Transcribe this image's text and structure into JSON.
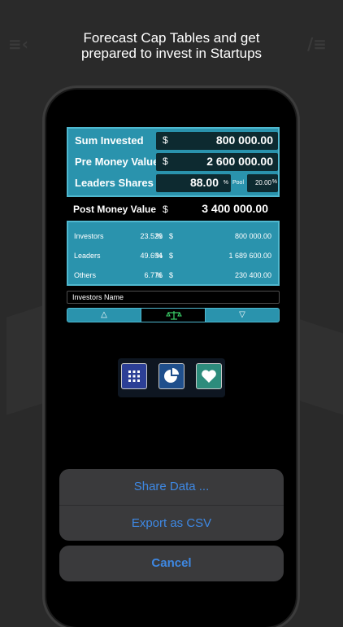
{
  "headline": {
    "line1": "Forecast Cap Tables and get",
    "line2": "prepared to invest in Startups"
  },
  "inputs": {
    "sum_invested": {
      "label": "Sum Invested",
      "currency": "$",
      "value": "800 000.00"
    },
    "pre_money": {
      "label": "Pre Money Value",
      "currency": "$",
      "value": "2 600 000.00"
    },
    "leaders_shares": {
      "label": "Leaders Shares",
      "value": "88.00",
      "unit": "%"
    },
    "pool": {
      "label": "Pool",
      "value": "20.00",
      "unit": "%"
    }
  },
  "post_money": {
    "label": "Post Money Value",
    "currency": "$",
    "value": "3 400 000.00"
  },
  "distribution": [
    {
      "name": "Investors",
      "percent": "23.529",
      "percent_sign": "%",
      "currency": "$",
      "amount": "800 000.00"
    },
    {
      "name": "Leaders",
      "percent": "49.694",
      "percent_sign": "%",
      "currency": "$",
      "amount": "1 689 600.00"
    },
    {
      "name": "Others",
      "percent": "6.776",
      "percent_sign": "%",
      "currency": "$",
      "amount": "230 400.00"
    }
  ],
  "investors_name": {
    "value": "Investors Name"
  },
  "segments": {
    "up": "△",
    "down": "▽"
  },
  "toolbar_icons": [
    "grid-icon",
    "pie-chart-icon",
    "heart-icon"
  ],
  "action_sheet": {
    "share": "Share Data ...",
    "export": "Export as CSV",
    "cancel": "Cancel"
  },
  "colors": {
    "panel": "#2a93ad",
    "panel_border": "#4fb8cf",
    "value_box": "#0d2a30",
    "action_text": "#3e88e3"
  }
}
